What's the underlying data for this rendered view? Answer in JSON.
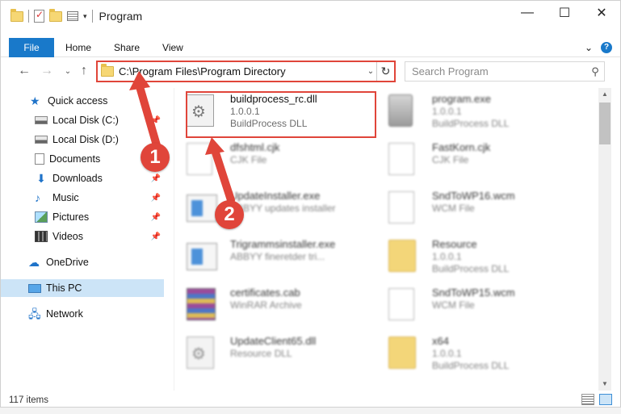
{
  "window": {
    "title": "Program",
    "controls": {
      "minimize": "—",
      "maximize": "☐",
      "close": "✕"
    }
  },
  "ribbon": {
    "tabs": [
      "File",
      "Home",
      "Share",
      "View"
    ],
    "expand": "⌄",
    "help": "?"
  },
  "address": {
    "path": "C:\\Program Files\\Program Directory",
    "refresh": "↻",
    "dropdown": "⌄"
  },
  "search": {
    "placeholder": "Search Program"
  },
  "nav": {
    "back": "←",
    "forward": "→",
    "recent": "⌄",
    "up": "↑"
  },
  "sidebar": {
    "quick_access": "Quick access",
    "items": [
      {
        "label": "Local Disk (C:)",
        "icon": "local-disk-icon",
        "pinned": true
      },
      {
        "label": "Local Disk (D:)",
        "icon": "local-disk-icon",
        "pinned": false
      },
      {
        "label": "Documents",
        "icon": "documents-icon",
        "pinned": true
      },
      {
        "label": "Downloads",
        "icon": "downloads-icon",
        "pinned": true
      },
      {
        "label": "Music",
        "icon": "music-icon",
        "pinned": true
      },
      {
        "label": "Pictures",
        "icon": "pictures-icon",
        "pinned": true
      },
      {
        "label": "Videos",
        "icon": "videos-icon",
        "pinned": true
      }
    ],
    "onedrive": "OneDrive",
    "this_pc": "This PC",
    "network": "Network"
  },
  "files": [
    {
      "name": "buildprocess_rc.dll",
      "version": "1.0.0.1",
      "desc": "BuildProcess DLL",
      "icon": "dll-icon"
    },
    {
      "name": "program.exe",
      "version": "1.0.0.1",
      "desc": "BuildProcess DLL",
      "icon": "program-icon"
    },
    {
      "name": "dfshtml.cjk",
      "version": "",
      "desc": "CJK File",
      "icon": "blank-file-icon"
    },
    {
      "name": "FastKorn.cjk",
      "version": "",
      "desc": "CJK File",
      "icon": "blank-file-icon"
    },
    {
      "name": "UpdateInstaller.exe",
      "version": "",
      "desc": "ABBYY updates installer",
      "icon": "exe-icon"
    },
    {
      "name": "SndToWP16.wcm",
      "version": "",
      "desc": "WCM File",
      "icon": "blank-file-icon"
    },
    {
      "name": "Trigrammsinstaller.exe",
      "version": "",
      "desc": "ABBYY fineretder tri...",
      "icon": "exe-icon"
    },
    {
      "name": "Resource",
      "version": "1.0.0.1",
      "desc": "BuildProcess DLL",
      "icon": "folder-icon"
    },
    {
      "name": "certificates.cab",
      "version": "",
      "desc": "WinRAR Archive",
      "icon": "rar-icon"
    },
    {
      "name": "SndToWP15.wcm",
      "version": "",
      "desc": "WCM File",
      "icon": "blank-file-icon"
    },
    {
      "name": "UpdateClient65.dll",
      "version": "",
      "desc": "Resource DLL",
      "icon": "dll-icon"
    },
    {
      "name": "x64",
      "version": "1.0.0.1",
      "desc": "BuildProcess DLL",
      "icon": "folder-icon"
    }
  ],
  "status": {
    "items": "117 items"
  },
  "annotations": {
    "step1": "1",
    "step2": "2"
  },
  "colors": {
    "accent": "#1979ca",
    "annotation": "#e0453a",
    "selection": "#cce4f7"
  }
}
